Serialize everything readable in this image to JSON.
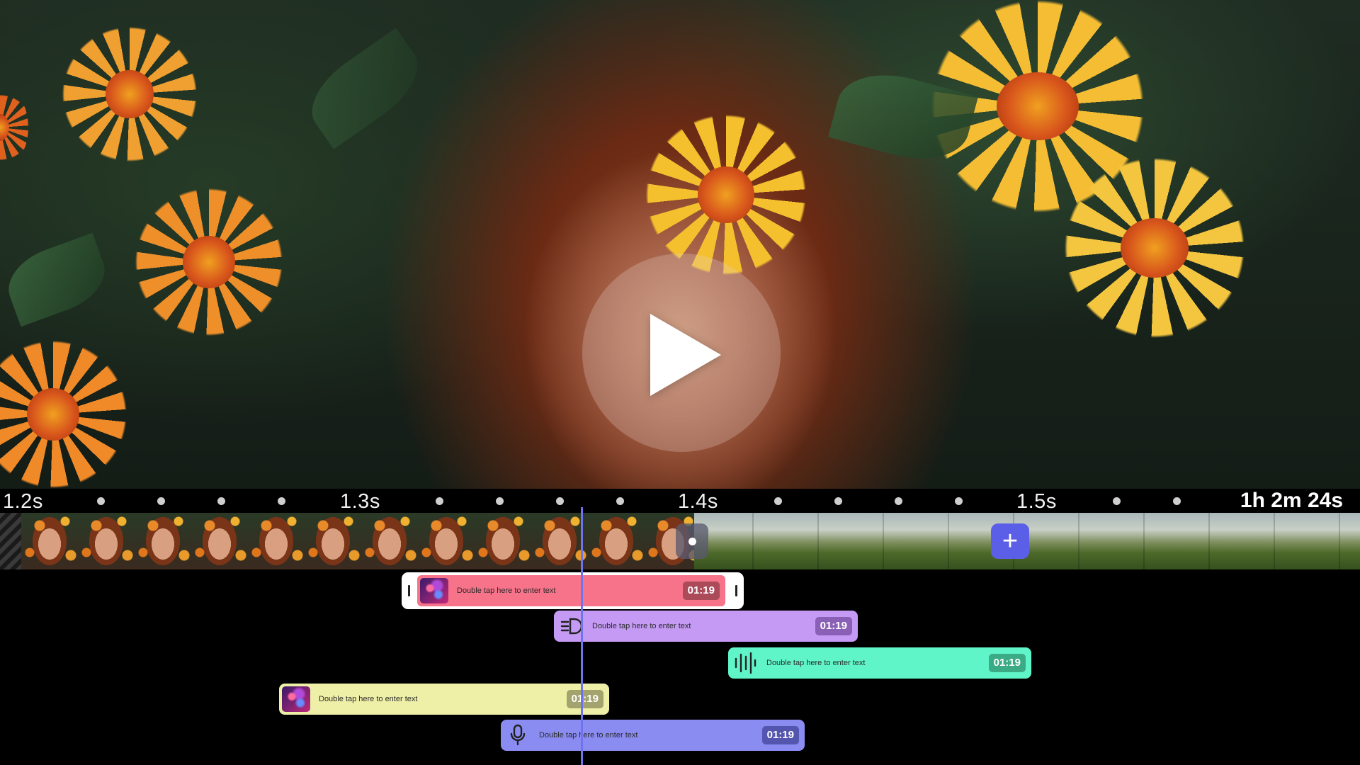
{
  "ruler": {
    "labels": [
      "1.2s",
      "1.3s",
      "1.4s",
      "1.5s"
    ],
    "duration": "1h 2m 24s"
  },
  "colors": {
    "accent": "#5b5fe8",
    "playhead": "#6f73f0",
    "track_text": "#f7738a",
    "track_effect": "#c59af5",
    "track_audio": "#5ff5c8",
    "track_overlay": "#eef0a8",
    "track_voice": "#8a8cf2"
  },
  "preview": {
    "play_icon": "play-icon"
  },
  "filmstrip": {
    "transition_icon": "dot-icon",
    "add_icon": "plus-icon",
    "add_label": "+"
  },
  "tracks": [
    {
      "kind": "text",
      "placeholder": "Double tap here to enter text",
      "time": "01:19",
      "icon": "media-thumbnail"
    },
    {
      "kind": "effect",
      "placeholder": "Double tap here to enter text",
      "time": "01:19",
      "icon": "speed-effect-icon"
    },
    {
      "kind": "audio",
      "placeholder": "Double tap here to enter text",
      "time": "01:19",
      "icon": "waveform-icon"
    },
    {
      "kind": "overlay",
      "placeholder": "Double tap here to enter text",
      "time": "01:19",
      "icon": "media-thumbnail"
    },
    {
      "kind": "voice",
      "placeholder": "Double tap here to enter text",
      "time": "01:19",
      "icon": "microphone-icon"
    }
  ]
}
